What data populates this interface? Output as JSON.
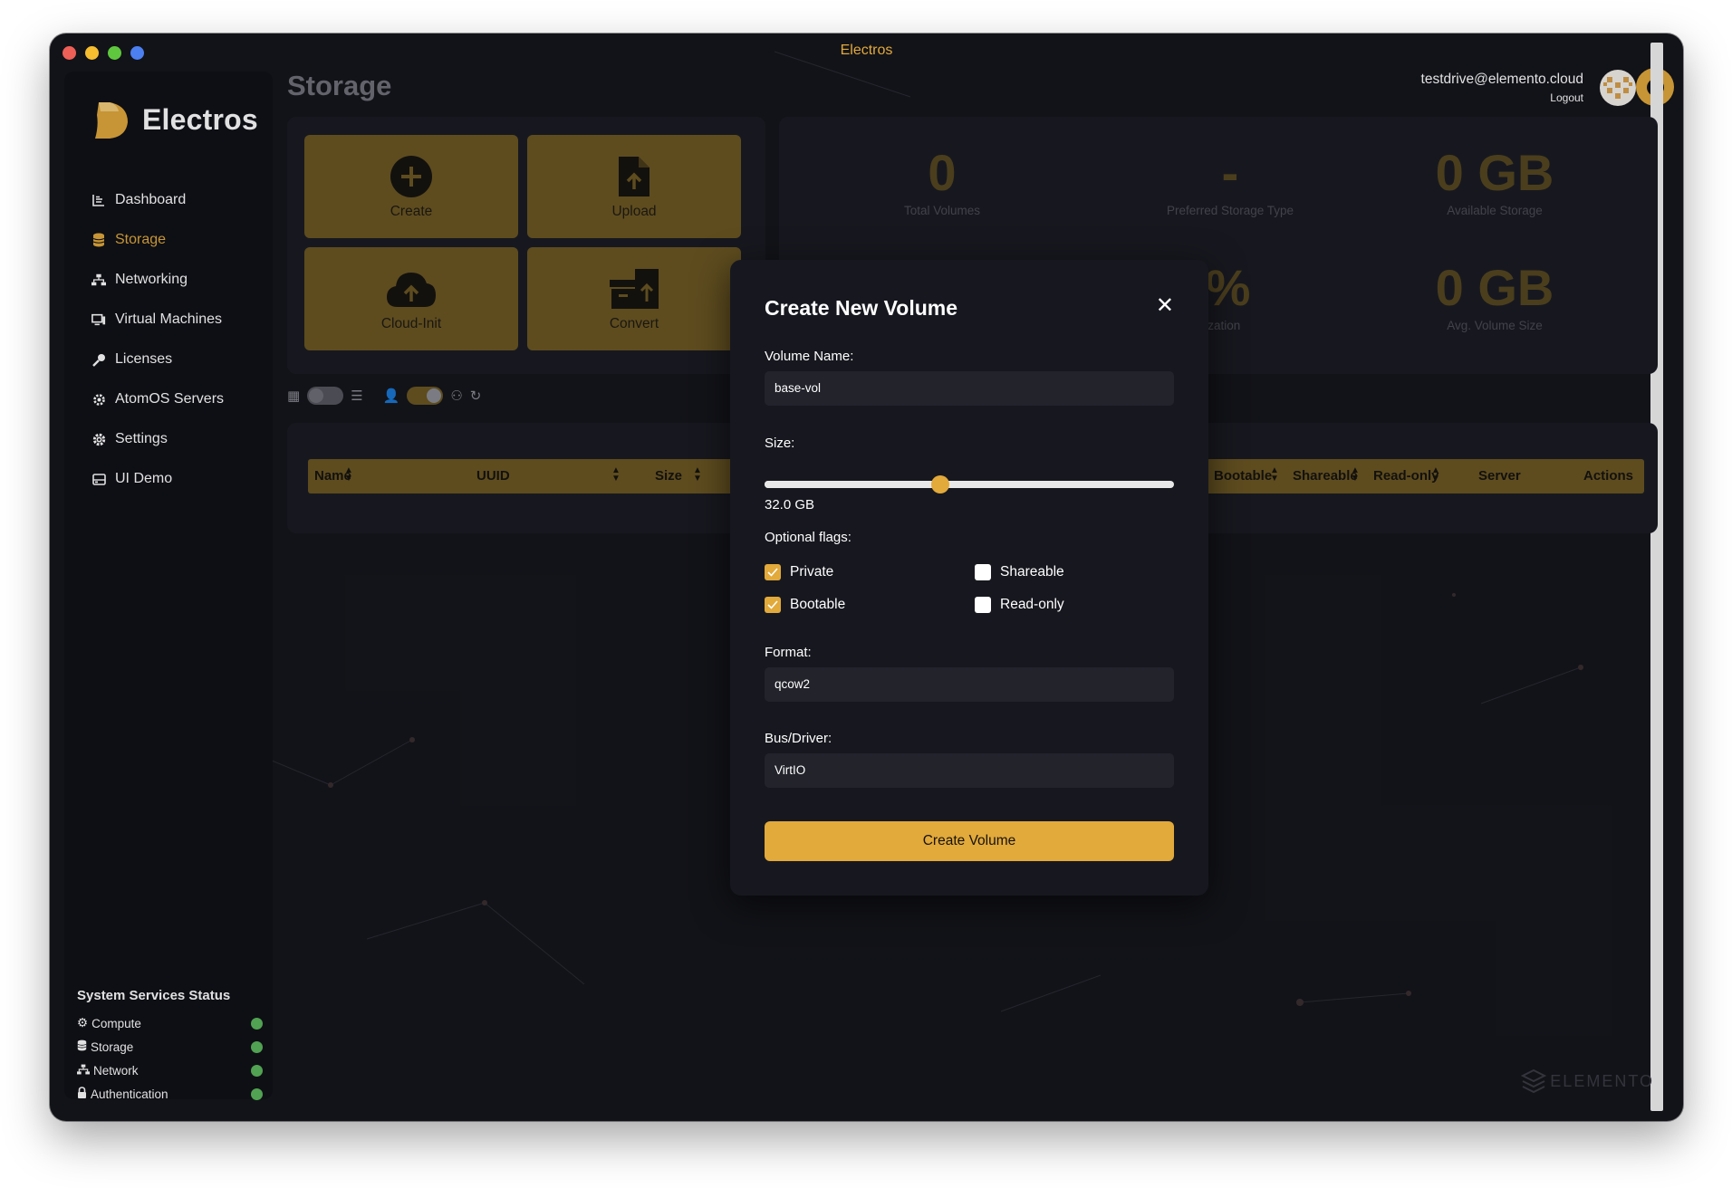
{
  "window": {
    "title": "Electros"
  },
  "brand": {
    "name": "Electros"
  },
  "sidebar": {
    "items": [
      {
        "label": "Dashboard",
        "icon": "chart-icon"
      },
      {
        "label": "Storage",
        "icon": "database-icon",
        "active": true
      },
      {
        "label": "Networking",
        "icon": "network-icon"
      },
      {
        "label": "Virtual Machines",
        "icon": "monitor-icon"
      },
      {
        "label": "Licenses",
        "icon": "key-icon"
      },
      {
        "label": "AtomOS Servers",
        "icon": "cog-icon"
      },
      {
        "label": "Settings",
        "icon": "gear-icon"
      },
      {
        "label": "UI Demo",
        "icon": "drive-icon"
      }
    ],
    "status_title": "System Services Status",
    "services": [
      {
        "label": "Compute",
        "icon": "chip-icon",
        "color": "#5cb85c"
      },
      {
        "label": "Storage",
        "icon": "database-icon",
        "color": "#5cb85c"
      },
      {
        "label": "Network",
        "icon": "network-icon",
        "color": "#5cb85c"
      },
      {
        "label": "Authentication",
        "icon": "lock-icon",
        "color": "#5cb85c"
      }
    ]
  },
  "page": {
    "title": "Storage"
  },
  "user": {
    "email": "testdrive@elemento.cloud",
    "logout": "Logout"
  },
  "tiles": [
    {
      "label": "Create",
      "icon": "plus-circle-icon"
    },
    {
      "label": "Upload",
      "icon": "file-upload-icon"
    },
    {
      "label": "Cloud-Init",
      "icon": "cloud-upload-icon"
    },
    {
      "label": "Convert",
      "icon": "archive-icon"
    }
  ],
  "stats": [
    {
      "value": "0",
      "label": "Total Volumes"
    },
    {
      "value": "-",
      "label": "Preferred Storage Type"
    },
    {
      "value": "0 GB",
      "label": "Available Storage"
    },
    {
      "value": "0%",
      "label": "Utilization"
    },
    {
      "value": "0 GB",
      "label": "Avg. Volume Size"
    }
  ],
  "table": {
    "columns": [
      "Name",
      "UUID",
      "Size",
      "Bootable",
      "Shareable",
      "Read-only",
      "Server",
      "Actions"
    ]
  },
  "modal": {
    "title": "Create New Volume",
    "volume_name_label": "Volume Name:",
    "volume_name_value": "base-vol",
    "size_label": "Size:",
    "size_value": "32.0 GB",
    "size_fraction": 0.43,
    "flags_label": "Optional flags:",
    "flags": [
      {
        "label": "Private",
        "checked": true
      },
      {
        "label": "Shareable",
        "checked": false
      },
      {
        "label": "Bootable",
        "checked": true
      },
      {
        "label": "Read-only",
        "checked": false
      }
    ],
    "format_label": "Format:",
    "format_value": "qcow2",
    "bus_label": "Bus/Driver:",
    "bus_value": "VirtIO",
    "submit_label": "Create Volume"
  },
  "footer_logo": "ELEMENTO",
  "colors": {
    "accent": "#e2a93b",
    "background": "#14151a",
    "status_ok": "#5cb85c"
  }
}
